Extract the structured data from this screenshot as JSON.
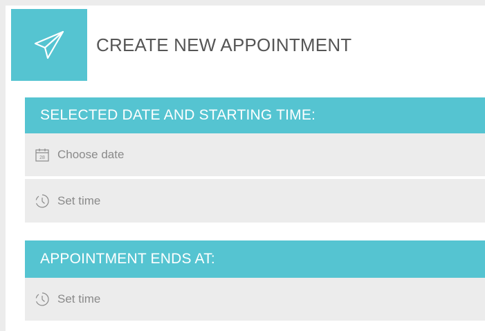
{
  "header": {
    "title": "CREATE NEW APPOINTMENT",
    "icon": "paper-plane-icon"
  },
  "start_section": {
    "title": "SELECTED DATE AND STARTING TIME:",
    "date_field": {
      "placeholder": "Choose date",
      "icon": "calendar-icon",
      "icon_text": "28"
    },
    "time_field": {
      "placeholder": "Set time",
      "icon": "clock-icon"
    }
  },
  "end_section": {
    "title": "APPOINTMENT ENDS AT:",
    "time_field": {
      "placeholder": "Set time",
      "icon": "clock-icon"
    }
  },
  "colors": {
    "accent": "#55c4d1",
    "field_background": "#ececec",
    "page_background": "#ffffff",
    "title_text": "#555555",
    "placeholder_text": "#8a8a8a"
  }
}
